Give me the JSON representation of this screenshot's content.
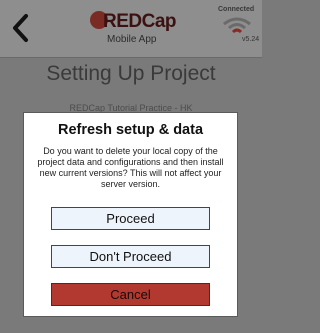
{
  "header": {
    "back_icon": "chevron-left-icon",
    "logo_text": "REDCap",
    "logo_subtitle": "Mobile App",
    "connection_status": "Connected",
    "version": "v5.24"
  },
  "page": {
    "title": "Setting Up Project",
    "subtitle": "REDCap Tutorial Practice - HK"
  },
  "dialog": {
    "title": "Refresh setup & data",
    "message": "Do you want to delete your local copy of the project data and configurations and then install new current versions? This will not affect your server version.",
    "buttons": {
      "proceed": "Proceed",
      "dont_proceed": "Don't Proceed",
      "cancel": "Cancel"
    }
  },
  "colors": {
    "overlay": "#7a7a7a",
    "header": "#8e8e8e",
    "button_fill": "#eef4fb",
    "button_border": "#2c4a6c",
    "cancel_fill": "#b1392f",
    "logo_red": "#7a2c24"
  }
}
